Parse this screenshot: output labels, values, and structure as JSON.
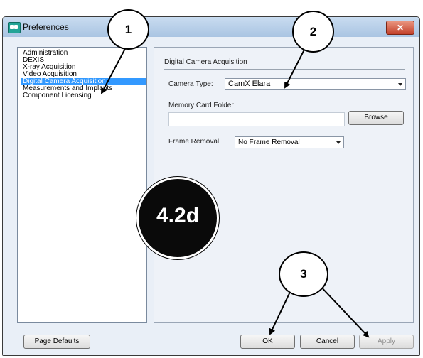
{
  "window": {
    "title": "Preferences",
    "close_glyph": "✕"
  },
  "sidebar": {
    "items": [
      {
        "label": "Administration",
        "selected": false
      },
      {
        "label": "DEXIS",
        "selected": false
      },
      {
        "label": "X-ray Acquisition",
        "selected": false
      },
      {
        "label": "Video Acquisition",
        "selected": false
      },
      {
        "label": "Digital Camera Acquisition",
        "selected": true
      },
      {
        "label": "Measurements and Implants",
        "selected": false
      },
      {
        "label": "Component Licensing",
        "selected": false
      }
    ]
  },
  "panel": {
    "title": "Digital Camera Acquisition",
    "camera_type_label": "Camera Type:",
    "camera_type_value": "CamX Elara",
    "memory_card_label": "Memory Card Folder",
    "memory_card_value": "",
    "browse_label": "Browse",
    "frame_removal_label": "Frame Removal:",
    "frame_removal_value": "No Frame Removal"
  },
  "footer": {
    "page_defaults_label": "Page Defaults",
    "ok_label": "OK",
    "cancel_label": "Cancel",
    "apply_label": "Apply"
  },
  "callouts": {
    "one": "1",
    "two": "2",
    "three": "3",
    "badge": "4.2d"
  },
  "colors": {
    "selection": "#3399ff",
    "close": "#c3412b",
    "window_bg": "#e9eff7"
  },
  "icons": {
    "app": "preferences-app-icon",
    "close": "close-icon",
    "dropdown": "chevron-down-icon"
  }
}
